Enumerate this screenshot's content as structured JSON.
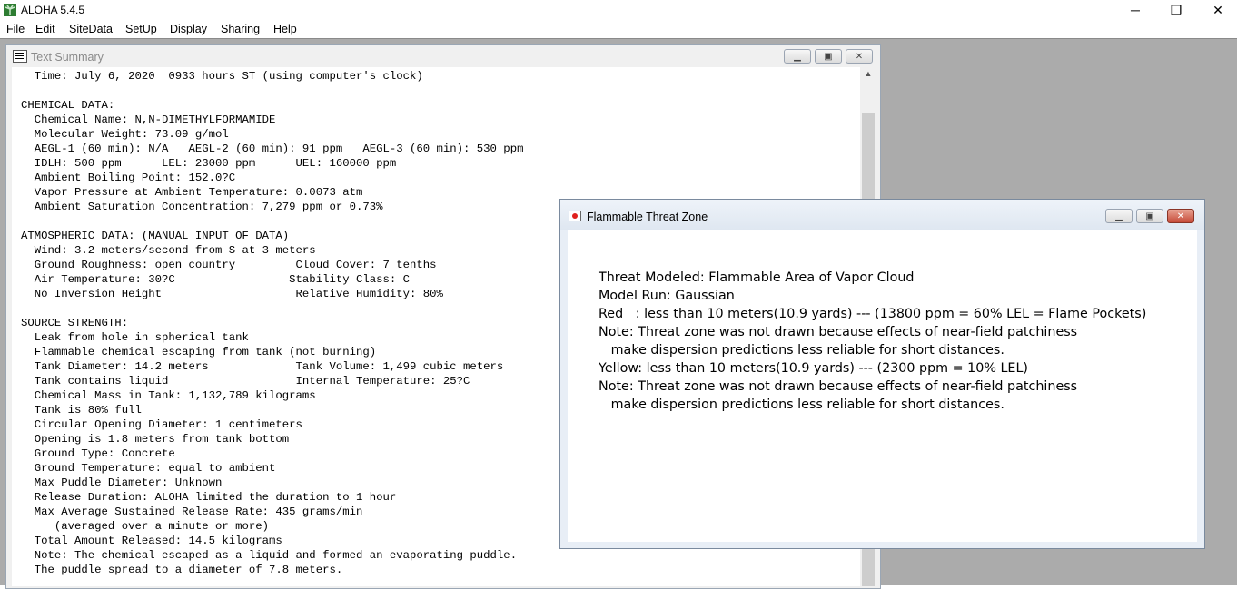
{
  "app": {
    "title": "ALOHA 5.4.5",
    "controls": {
      "minimize": "─",
      "restore": "❐",
      "close": "✕"
    }
  },
  "menu": [
    "File",
    "Edit",
    "SiteData",
    "SetUp",
    "Display",
    "Sharing",
    "Help"
  ],
  "text_summary": {
    "title": "Text Summary",
    "lines": [
      "  Time: July 6, 2020  0933 hours ST (using computer's clock)",
      "",
      "CHEMICAL DATA:",
      "  Chemical Name: N,N-DIMETHYLFORMAMIDE",
      "  Molecular Weight: 73.09 g/mol",
      "  AEGL-1 (60 min): N/A   AEGL-2 (60 min): 91 ppm   AEGL-3 (60 min): 530 ppm",
      "  IDLH: 500 ppm      LEL: 23000 ppm      UEL: 160000 ppm",
      "  Ambient Boiling Point: 152.0?C",
      "  Vapor Pressure at Ambient Temperature: 0.0073 atm",
      "  Ambient Saturation Concentration: 7,279 ppm or 0.73%",
      "",
      "ATMOSPHERIC DATA: (MANUAL INPUT OF DATA)",
      "  Wind: 3.2 meters/second from S at 3 meters",
      "  Ground Roughness: open country         Cloud Cover: 7 tenths",
      "  Air Temperature: 30?C                 Stability Class: C",
      "  No Inversion Height                    Relative Humidity: 80%",
      "",
      "SOURCE STRENGTH:",
      "  Leak from hole in spherical tank",
      "  Flammable chemical escaping from tank (not burning)",
      "  Tank Diameter: 14.2 meters             Tank Volume: 1,499 cubic meters",
      "  Tank contains liquid                   Internal Temperature: 25?C",
      "  Chemical Mass in Tank: 1,132,789 kilograms",
      "  Tank is 80% full",
      "  Circular Opening Diameter: 1 centimeters",
      "  Opening is 1.8 meters from tank bottom",
      "  Ground Type: Concrete",
      "  Ground Temperature: equal to ambient",
      "  Max Puddle Diameter: Unknown",
      "  Release Duration: ALOHA limited the duration to 1 hour",
      "  Max Average Sustained Release Rate: 435 grams/min",
      "     (averaged over a minute or more)",
      "  Total Amount Released: 14.5 kilograms",
      "  Note: The chemical escaped as a liquid and formed an evaporating puddle.",
      "  The puddle spread to a diameter of 7.8 meters."
    ]
  },
  "threat_zone": {
    "title": "Flammable Threat Zone",
    "lines": [
      "Threat Modeled: Flammable Area of Vapor Cloud",
      "Model Run: Gaussian",
      "Red   : less than 10 meters(10.9 yards) --- (13800 ppm = 60% LEL = Flame Pockets)",
      "Note: Threat zone was not drawn because effects of near-field patchiness",
      "   make dispersion predictions less reliable for short distances.",
      "Yellow: less than 10 meters(10.9 yards) --- (2300 ppm = 10% LEL)",
      "Note: Threat zone was not drawn because effects of near-field patchiness",
      "   make dispersion predictions less reliable for short distances."
    ]
  }
}
